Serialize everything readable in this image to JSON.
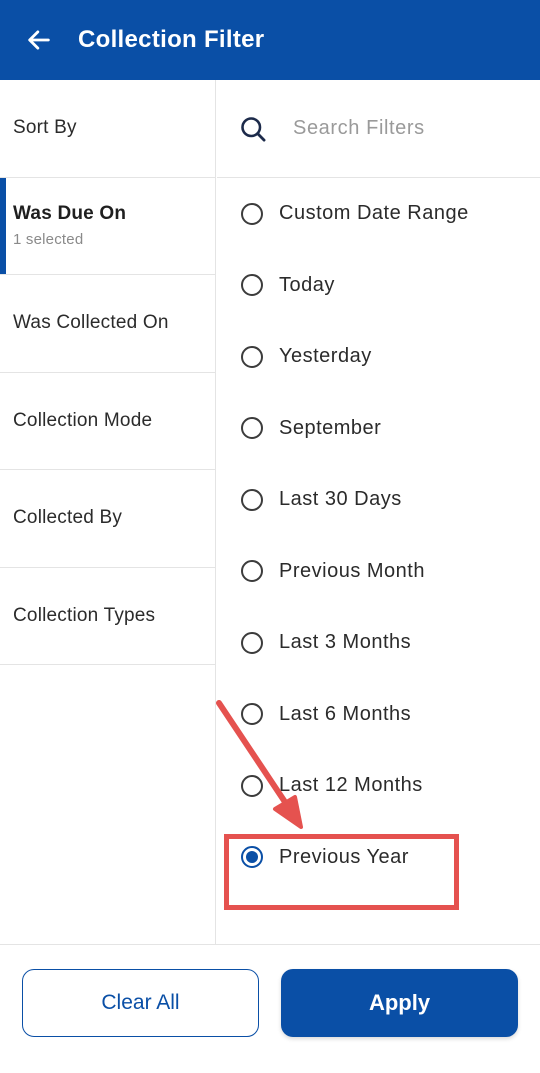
{
  "header": {
    "title": "Collection Filter",
    "back_icon": "arrow-left-icon"
  },
  "sidebar": {
    "items": [
      {
        "label": "Sort By",
        "sub": ""
      },
      {
        "label": "Was Due On",
        "sub": "1 selected",
        "active": true
      },
      {
        "label": "Was Collected On",
        "sub": ""
      },
      {
        "label": "Collection Mode",
        "sub": ""
      },
      {
        "label": "Collected By",
        "sub": ""
      },
      {
        "label": "Collection Types",
        "sub": ""
      }
    ]
  },
  "search": {
    "placeholder": "Search Filters",
    "icon": "search-icon"
  },
  "options": [
    {
      "label": "Custom Date Range",
      "selected": false
    },
    {
      "label": "Today",
      "selected": false
    },
    {
      "label": "Yesterday",
      "selected": false
    },
    {
      "label": "September",
      "selected": false
    },
    {
      "label": "Last 30 Days",
      "selected": false
    },
    {
      "label": "Previous Month",
      "selected": false
    },
    {
      "label": "Last 3 Months",
      "selected": false
    },
    {
      "label": "Last 6 Months",
      "selected": false
    },
    {
      "label": "Last 12 Months",
      "selected": false
    },
    {
      "label": "Previous Year",
      "selected": true
    }
  ],
  "footer": {
    "clear_label": "Clear All",
    "apply_label": "Apply"
  },
  "colors": {
    "brand": "#0a4fa6",
    "annotation": "#e5524f"
  }
}
